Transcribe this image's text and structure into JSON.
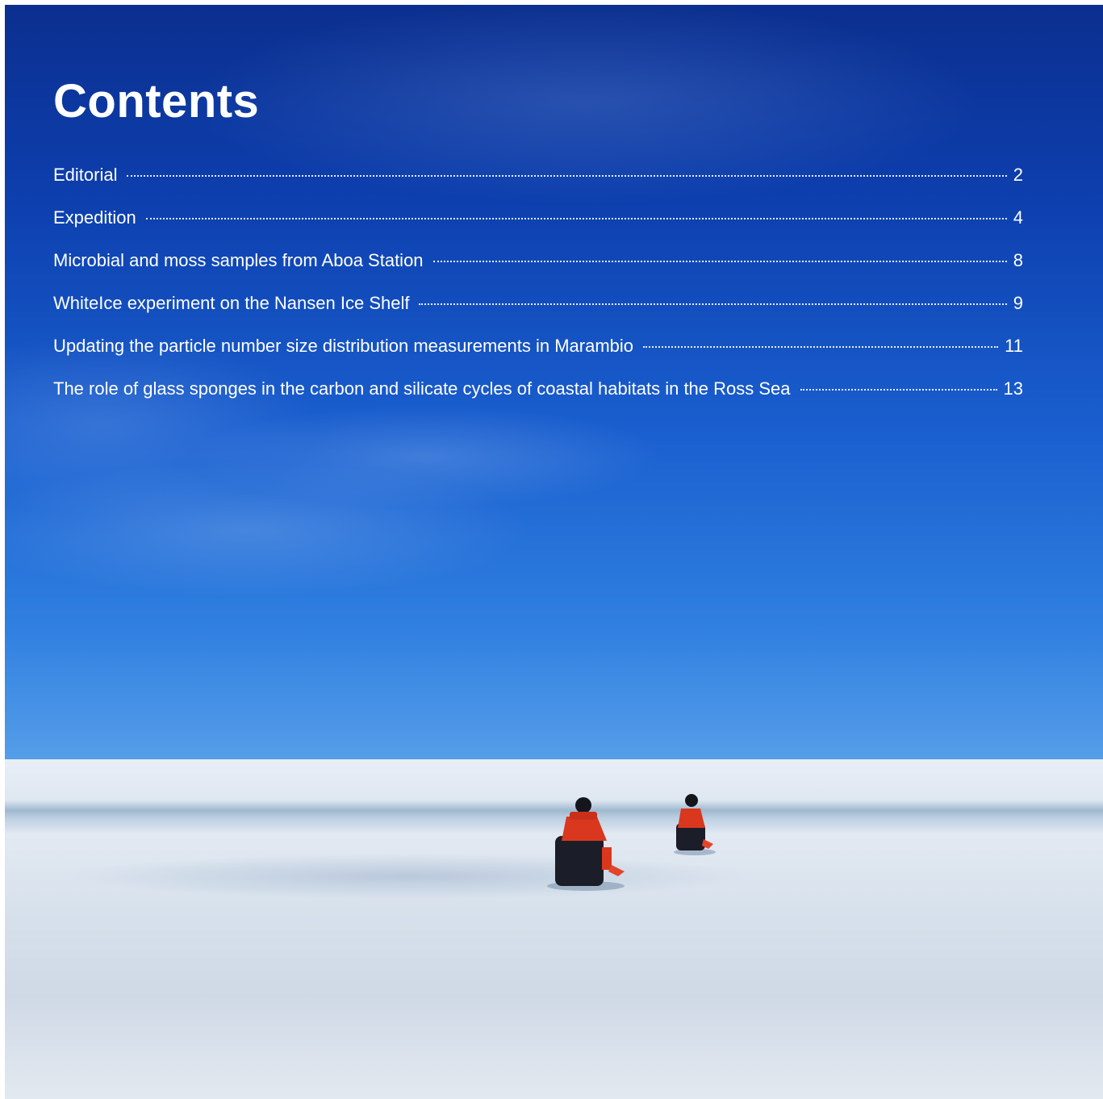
{
  "heading": "Contents",
  "toc": [
    {
      "title": "Editorial",
      "page": "2"
    },
    {
      "title": "Expedition",
      "page": "4"
    },
    {
      "title": "Microbial and moss samples from Aboa Station",
      "page": "8"
    },
    {
      "title": "WhiteIce experiment on the Nansen Ice Shelf",
      "page": "9"
    },
    {
      "title": "Updating the particle number size distribution measurements in Marambio",
      "page": "11"
    },
    {
      "title": "The role of glass sponges in the carbon and silicate cycles of coastal habitats in the Ross Sea",
      "page": "13"
    }
  ],
  "colors": {
    "sky_top": "#0b2f8f",
    "sky_bottom": "#5aa2ea",
    "snow": "#dfe7f1",
    "text": "#ffffff",
    "rider_suit": "#d9381e"
  },
  "background_photo": "snowmobile-riders-on-antarctic-ice-photo"
}
